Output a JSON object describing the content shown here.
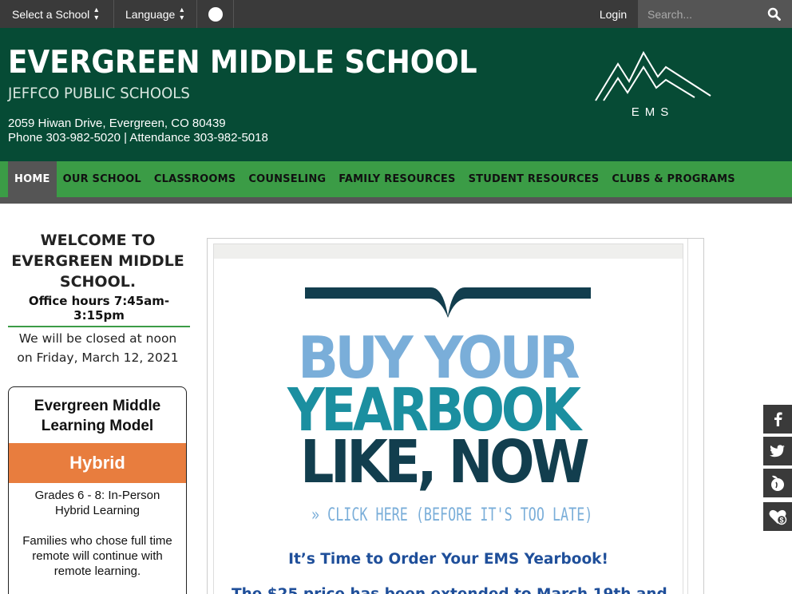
{
  "topbar": {
    "select_school": "Select a School",
    "language": "Language",
    "login": "Login",
    "search_placeholder": "Search..."
  },
  "header": {
    "school_name": "EVERGREEN MIDDLE SCHOOL",
    "district": "JEFFCO PUBLIC SCHOOLS",
    "address": "2059 Hiwan Drive, Evergreen, CO 80439",
    "phone": "Phone 303-982-5020 | Attendance 303-982-5018",
    "logo_text": "EMS"
  },
  "nav": {
    "items": [
      {
        "label": "HOME",
        "active": true
      },
      {
        "label": "OUR SCHOOL"
      },
      {
        "label": "CLASSROOMS"
      },
      {
        "label": "COUNSELING"
      },
      {
        "label": "FAMILY RESOURCES"
      },
      {
        "label": "STUDENT RESOURCES"
      },
      {
        "label": "CLUBS & PROGRAMS"
      }
    ]
  },
  "sidebar": {
    "welcome_line1": "WELCOME TO",
    "welcome_line2": "EVERGREEN MIDDLE",
    "welcome_line3": "SCHOOL.",
    "office_hours": "Office hours 7:45am-3:15pm",
    "closed_line1": "We will be closed at noon",
    "closed_line2": "on Friday, March 12, 2021",
    "model_title_line1": "Evergreen Middle",
    "model_title_line2": "Learning Model",
    "model_status": "Hybrid",
    "grades_line1": "Grades 6 - 8: In-Person",
    "grades_line2": "Hybrid Learning",
    "families_line1": "Families who chose full time",
    "families_line2": "remote will continue with",
    "families_line3": "remote learning."
  },
  "main": {
    "banner_line1": "BUY YOUR",
    "banner_line2": "YEARBOOK",
    "banner_line3": "LIKE, NOW",
    "banner_link": "» CLICK HERE (BEFORE IT'S TOO LATE)",
    "order_heading": "It’s Time to Order Your EMS Yearbook!",
    "cutoff_text": "The $25 price has been extended to March 19th and"
  },
  "social": {
    "icons": [
      "facebook-icon",
      "twitter-icon",
      "peachjar-icon",
      "donate-icon"
    ]
  },
  "colors": {
    "header_green": "#064b35",
    "nav_green": "#3b9c46",
    "hybrid_orange": "#e87d3e",
    "buy_blue": "#7aaed9",
    "yearbook_teal": "#1b8fa0",
    "likenow_navy": "#123e4e",
    "order_blue": "#1f4f9a"
  }
}
